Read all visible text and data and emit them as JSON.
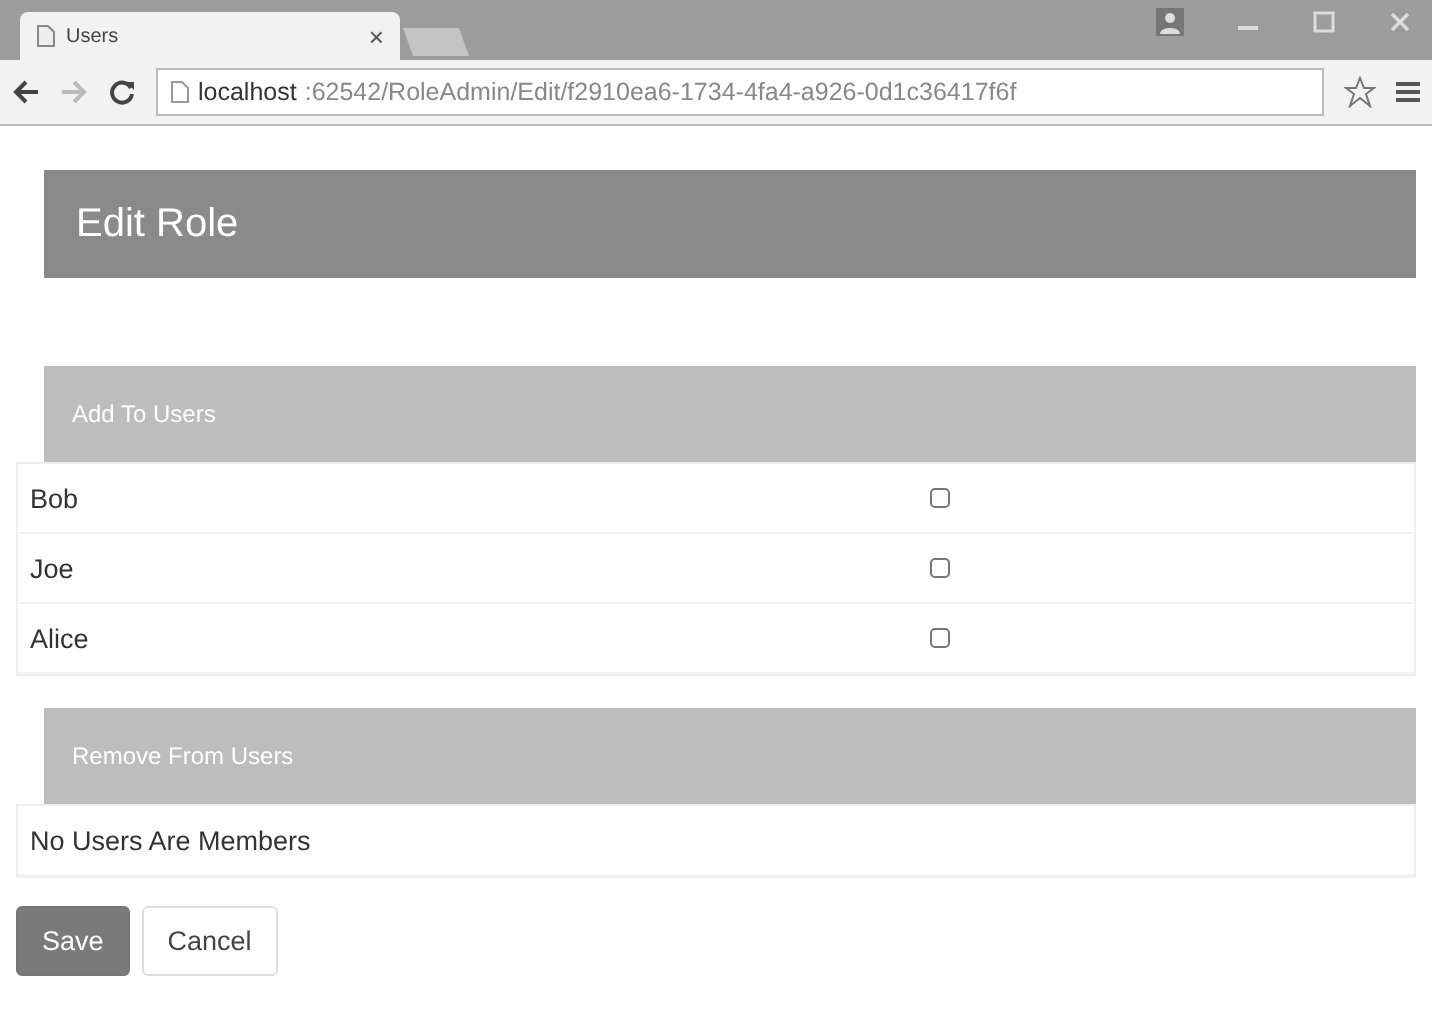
{
  "browser": {
    "tab": {
      "title": "Users",
      "close": "×"
    },
    "address": {
      "host": "localhost",
      "path": ":62542/RoleAdmin/Edit/f2910ea6-1734-4fa4-a926-0d1c36417f6f"
    }
  },
  "header": {
    "title": "Edit Role"
  },
  "panels": [
    {
      "title": "Add To Users",
      "kind": "users",
      "users": [
        {
          "name": "Bob",
          "checked": false
        },
        {
          "name": "Joe",
          "checked": false
        },
        {
          "name": "Alice",
          "checked": false
        }
      ]
    },
    {
      "title": "Remove From Users",
      "kind": "empty",
      "message": "No Users Are Members"
    }
  ],
  "buttons": [
    {
      "label": "Save",
      "kind": "primary"
    },
    {
      "label": "Cancel",
      "kind": "default"
    }
  ]
}
